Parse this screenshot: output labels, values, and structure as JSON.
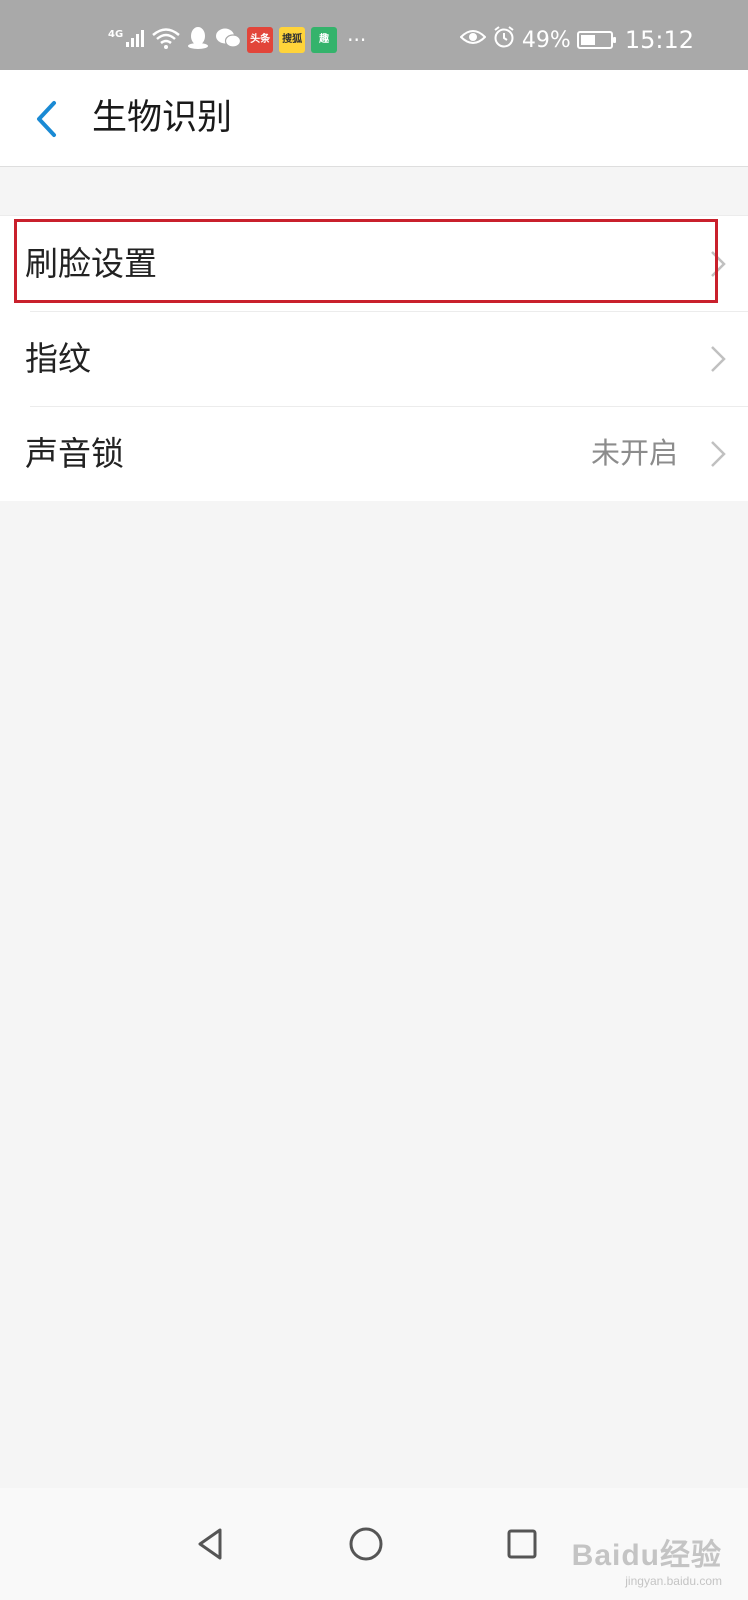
{
  "status_bar": {
    "network_label": "4G",
    "app_badges": [
      {
        "icon": "toutiao-app-icon",
        "text": "头条"
      },
      {
        "icon": "sousou-app-icon",
        "text": "搜狐"
      },
      {
        "icon": "qu-app-icon",
        "text": "趣"
      }
    ],
    "more": "···",
    "battery_percent": "49%",
    "battery_level": 0.49,
    "time": "15:12"
  },
  "header": {
    "title": "生物识别",
    "back_icon": "chevron-left-icon",
    "accent_color": "#1a8ad4"
  },
  "list": {
    "items": [
      {
        "label": "刷脸设置",
        "value": "",
        "highlighted": true
      },
      {
        "label": "指纹",
        "value": ""
      },
      {
        "label": "声音锁",
        "value": "未开启"
      }
    ],
    "highlight_color": "#c9202c"
  },
  "nav": {
    "back_icon": "triangle-back-icon",
    "home_icon": "circle-home-icon",
    "recent_icon": "square-recent-icon"
  },
  "watermark": {
    "brand": "Baidu经验",
    "url": "jingyan.baidu.com"
  }
}
